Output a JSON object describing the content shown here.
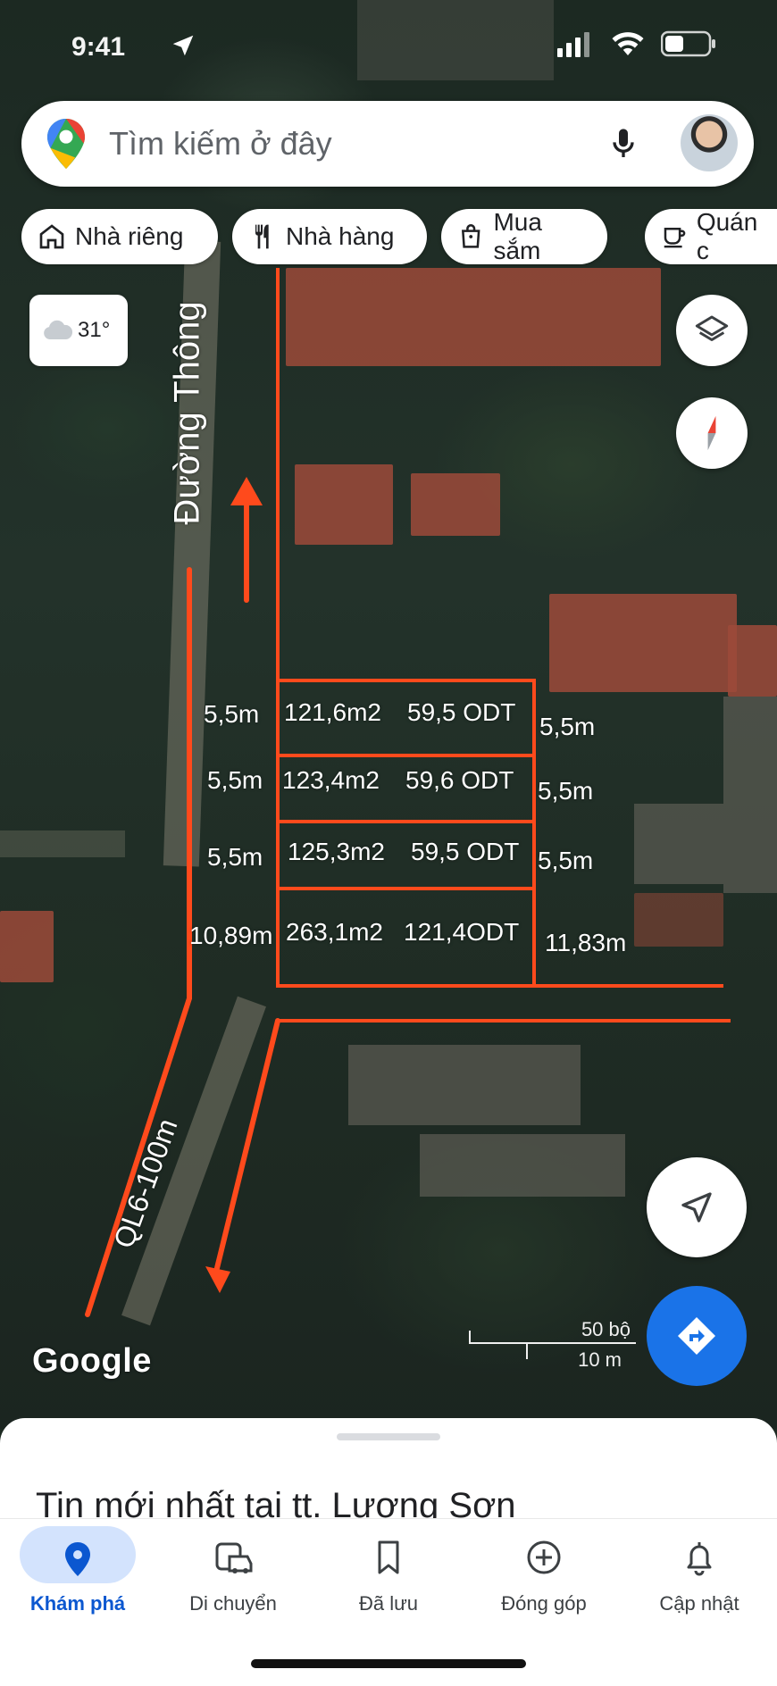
{
  "status_bar": {
    "time": "9:41"
  },
  "search": {
    "placeholder": "Tìm kiếm ở đây"
  },
  "chips": [
    "Nhà riêng",
    "Nhà hàng",
    "Mua sắm",
    "Quán c"
  ],
  "weather": {
    "temp": "31°"
  },
  "overlay": {
    "road_label": "Đường Thông",
    "highway_label": "QL6-100m",
    "lots": [
      {
        "left": "5,5m",
        "area": "121,6m2",
        "odt": "59,5 ODT",
        "right": "5,5m"
      },
      {
        "left": "5,5m",
        "area": "123,4m2",
        "odt": "59,6 ODT",
        "right": "5,5m"
      },
      {
        "left": "5,5m",
        "area": "125,3m2",
        "odt": "59,5 ODT",
        "right": "5,5m"
      },
      {
        "left": "10,89m",
        "area": "263,1m2",
        "odt": "121,4ODT",
        "right": "11,83m"
      }
    ]
  },
  "map": {
    "attribution": "Google",
    "scale_ft": "50 bộ",
    "scale_m": "10 m"
  },
  "sheet": {
    "title": "Tin mới nhất tại tt. Lương Sơn"
  },
  "nav": [
    {
      "label": "Khám phá",
      "icon": "pin-icon",
      "active": true
    },
    {
      "label": "Di chuyển",
      "icon": "car-icon"
    },
    {
      "label": "Đã lưu",
      "icon": "bookmark-icon"
    },
    {
      "label": "Đóng góp",
      "icon": "plus-circle-icon"
    },
    {
      "label": "Cập nhật",
      "icon": "bell-icon"
    }
  ],
  "colors": {
    "accent": "#1a73e8",
    "overlay_line": "#ff4a1c",
    "active_pill": "#d3e3fd"
  }
}
